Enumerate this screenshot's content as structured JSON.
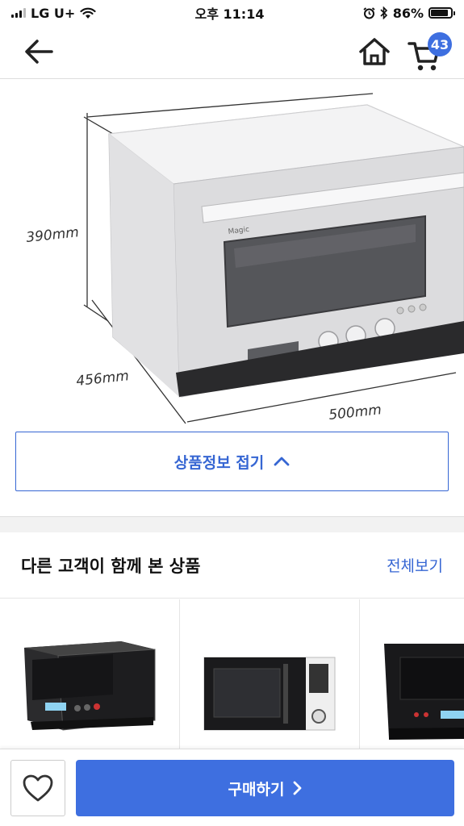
{
  "status_bar": {
    "carrier": "LG U+",
    "time": "오후 11:14",
    "battery": "86%",
    "battery_level": 0.86
  },
  "nav": {
    "cart_count": "43"
  },
  "product_image": {
    "dim_height": "390mm",
    "dim_depth": "456mm",
    "dim_width": "500mm",
    "brand_text": "Magic"
  },
  "collapse_button": {
    "label": "상품정보 접기"
  },
  "related": {
    "title": "다른 고객이 함께 본 상품",
    "view_all": "전체보기"
  },
  "bottom_bar": {
    "buy_label": "구매하기"
  },
  "colors": {
    "accent": "#3e6fe0",
    "accent_text": "#3666d3"
  }
}
